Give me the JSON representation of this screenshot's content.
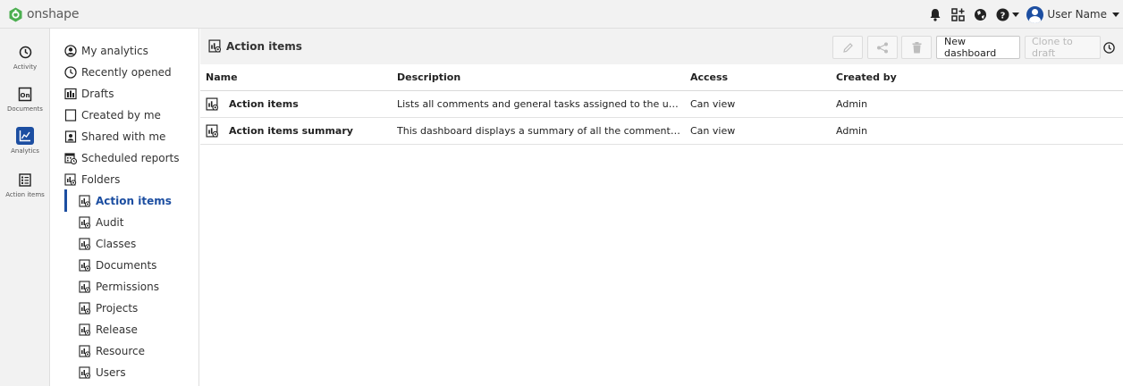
{
  "app": {
    "name": "onshape"
  },
  "topbar": {
    "user_name": "User Name",
    "icons": [
      "bell-icon",
      "apps-icon",
      "globe-icon",
      "help-icon"
    ]
  },
  "rail": {
    "items": [
      {
        "label": "Activity",
        "icon": "clock-icon"
      },
      {
        "label": "Documents",
        "icon": "documents-icon"
      },
      {
        "label": "Analytics",
        "icon": "analytics-icon",
        "active": true
      },
      {
        "label": "Action items",
        "icon": "checklist-icon"
      }
    ]
  },
  "tree": {
    "items": [
      {
        "label": "My analytics",
        "icon": "user-circle-icon"
      },
      {
        "label": "Recently opened",
        "icon": "clock-icon"
      },
      {
        "label": "Drafts",
        "icon": "drafts-icon"
      },
      {
        "label": "Created by me",
        "icon": "page-icon"
      },
      {
        "label": "Shared with me",
        "icon": "shared-icon"
      },
      {
        "label": "Scheduled reports",
        "icon": "calendar-icon"
      },
      {
        "label": "Folders",
        "icon": "dashboard-icon"
      },
      {
        "label": "Action items",
        "icon": "dashboard-icon",
        "active": true
      },
      {
        "label": "Audit",
        "icon": "dashboard-icon"
      },
      {
        "label": "Classes",
        "icon": "dashboard-icon"
      },
      {
        "label": "Documents",
        "icon": "dashboard-icon"
      },
      {
        "label": "Permissions",
        "icon": "dashboard-icon"
      },
      {
        "label": "Projects",
        "icon": "dashboard-icon"
      },
      {
        "label": "Release",
        "icon": "dashboard-icon"
      },
      {
        "label": "Resource",
        "icon": "dashboard-icon"
      },
      {
        "label": "Users",
        "icon": "dashboard-icon"
      }
    ]
  },
  "main": {
    "title": "Action items",
    "toolbar": {
      "new_dashboard": "New dashboard",
      "clone_to_draft": "Clone to draft"
    },
    "table": {
      "columns": [
        "Name",
        "Description",
        "Access",
        "Created by"
      ],
      "rows": [
        {
          "name": "Action items",
          "description": "Lists all comments and general tasks assigned to the users.",
          "access": "Can view",
          "created_by": "Admin"
        },
        {
          "name": "Action items summary",
          "description": "This dashboard displays a summary of all the comments and g...",
          "access": "Can view",
          "created_by": "Admin"
        }
      ]
    }
  },
  "colors": {
    "accent": "#1c4ea1",
    "logo_green": "#4caf50",
    "chrome": "#f2f2f2"
  }
}
